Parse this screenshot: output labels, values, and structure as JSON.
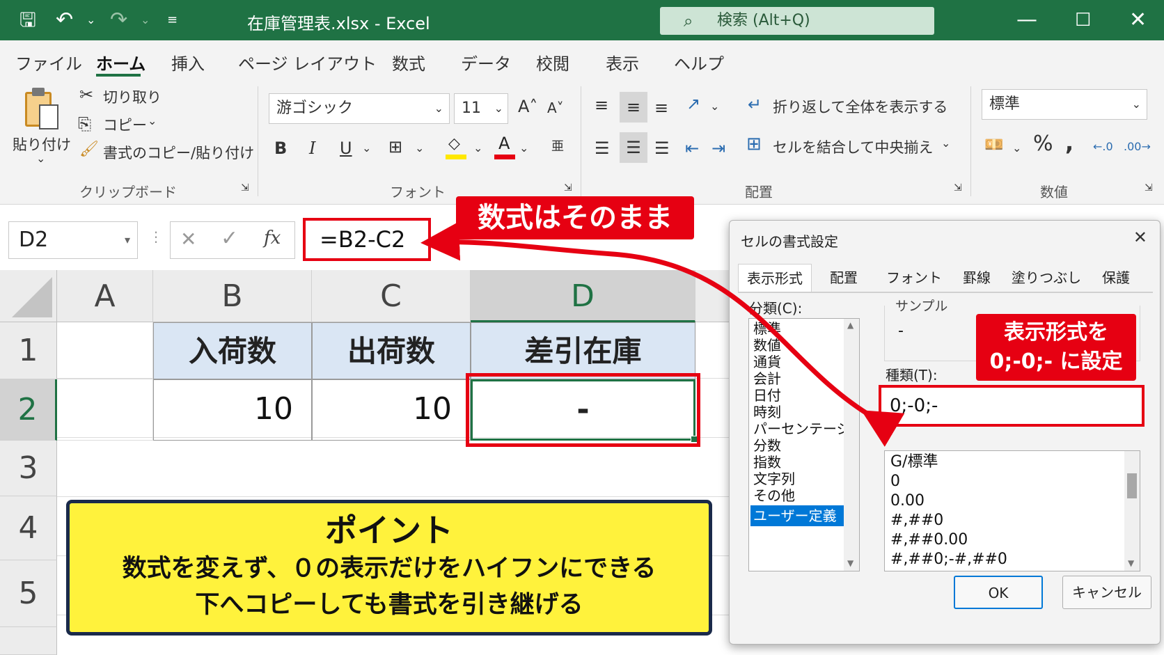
{
  "window": {
    "title": "在庫管理表.xlsx  -  Excel",
    "search": "検索 (Alt+Q)"
  },
  "menu": [
    "ファイル",
    "ホーム",
    "挿入",
    "ページ レイアウト",
    "数式",
    "データ",
    "校閲",
    "表示",
    "ヘルプ"
  ],
  "ribbon": {
    "paste": "貼り付け",
    "cut": "切り取り",
    "copy": "コピー",
    "format_painter": "書式のコピー/貼り付け",
    "clipboard_group": "クリップボード",
    "font_name": "游ゴシック",
    "font_size": "11",
    "font_group": "フォント",
    "wrap_text": "折り返して全体を表示する",
    "merge_center": "セルを結合して中央揃え",
    "alignment_group": "配置",
    "number_format": "標準",
    "number_group": "数値"
  },
  "formula_bar": {
    "name_box": "D2",
    "formula": "=B2-C2",
    "fx": "fx"
  },
  "callouts": {
    "formula": "数式はそのまま",
    "format_line1": "表示形式を",
    "format_line2": "0;-0;- に設定"
  },
  "sheet": {
    "columns": [
      "A",
      "B",
      "C",
      "D"
    ],
    "rows": [
      "1",
      "2",
      "3",
      "4",
      "5"
    ],
    "headers": {
      "B1": "入荷数",
      "C1": "出荷数",
      "D1": "差引在庫"
    },
    "values": {
      "B2": "10",
      "C2": "10",
      "D2": "-"
    }
  },
  "point": {
    "title": "ポイント",
    "line1": "数式を変えず、０の表示だけをハイフンにできる",
    "line2": "下へコピーしても書式を引き継げる"
  },
  "dialog": {
    "title": "セルの書式設定",
    "tabs": [
      "表示形式",
      "配置",
      "フォント",
      "罫線",
      "塗りつぶし",
      "保護"
    ],
    "category_label": "分類(C):",
    "categories": [
      "標準",
      "数値",
      "通貨",
      "会計",
      "日付",
      "時刻",
      "パーセンテージ",
      "分数",
      "指数",
      "文字列",
      "その他",
      "ユーザー定義"
    ],
    "sample_label": "サンプル",
    "sample_value": "-",
    "type_label": "種類(T):",
    "type_value": "0;-0;-",
    "types": [
      "G/標準",
      "0",
      "0.00",
      "#,##0",
      "#,##0.00",
      "#,##0;-#,##0"
    ],
    "ok": "OK",
    "cancel": "キャンセル"
  },
  "colors": {
    "excel_green": "#1f7244",
    "callout_red": "#e60012",
    "point_yellow": "#fff23c",
    "selection_blue": "#0078d7"
  }
}
